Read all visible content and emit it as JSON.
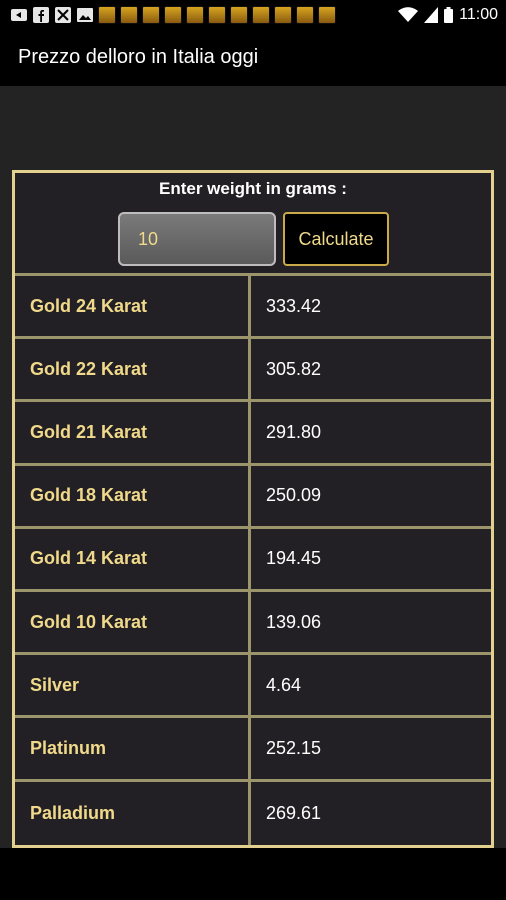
{
  "status_bar": {
    "time": "11:00",
    "icons": [
      "back-icon",
      "facebook-icon",
      "tools-icon",
      "image-icon",
      "app-notification-icon",
      "wifi-icon",
      "signal-icon",
      "battery-icon"
    ]
  },
  "app_bar": {
    "title": "Prezzo delloro in Italia oggi"
  },
  "calculator": {
    "prompt": "Enter weight in grams :",
    "weight_value": "10",
    "button_label": "Calculate"
  },
  "prices": [
    {
      "name": "Gold 24 Karat",
      "value": "333.42"
    },
    {
      "name": "Gold 22 Karat",
      "value": "305.82"
    },
    {
      "name": "Gold 21 Karat",
      "value": "291.80"
    },
    {
      "name": "Gold 18 Karat",
      "value": "250.09"
    },
    {
      "name": "Gold 14 Karat",
      "value": "194.45"
    },
    {
      "name": "Gold 10 Karat",
      "value": "139.06"
    },
    {
      "name": "Silver",
      "value": "4.64"
    },
    {
      "name": "Platinum",
      "value": "252.15"
    },
    {
      "name": "Palladium",
      "value": "269.61"
    }
  ],
  "colors": {
    "accent_gold": "#f0d98a",
    "border_gold": "#e3d08f",
    "background": "#222222"
  }
}
